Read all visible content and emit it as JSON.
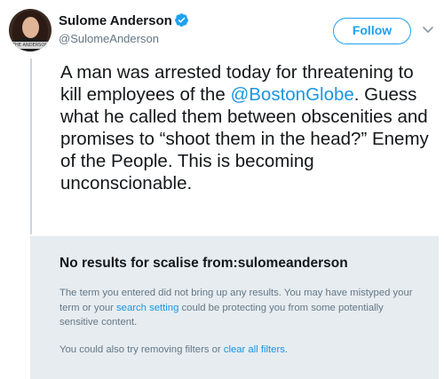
{
  "tweet": {
    "author_name": "Sulome Anderson",
    "author_handle": "@SulomeAnderson",
    "follow_label": "Follow",
    "avatar_tag": "THE ANDERSON",
    "text_before": "A man was arrested today for threatening to kill employees of the ",
    "mention": "@BostonGlobe",
    "text_after": ". Guess what he called them between obscenities and promises to “shoot them in the head?” Enemy of the People. This is becoming unconscionable."
  },
  "search": {
    "title": "No results for scalise from:sulomeanderson",
    "body_1_start": "The term you entered did not bring up any results. You may have mistyped your term or your ",
    "body_1_link": "search setting",
    "body_1_end": " could be protecting you from some potentially sensitive content.",
    "body_2_start": "You could also try removing filters or ",
    "body_2_link": "clear all filters",
    "body_2_end": "."
  },
  "colors": {
    "accent": "#1da1f2",
    "link": "#1b95e0",
    "panel_bg": "#e6ecf0",
    "muted_text": "#657786"
  },
  "icons": {
    "verified": "verified-badge-icon",
    "chevron": "chevron-down-icon"
  }
}
